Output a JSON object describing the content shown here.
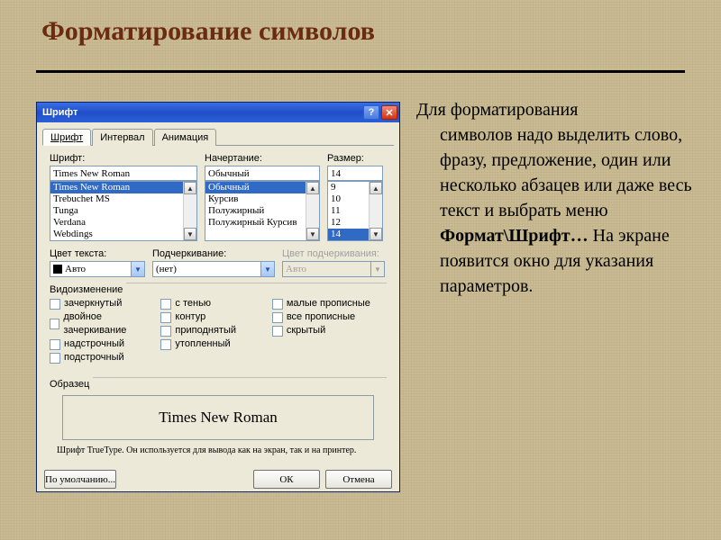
{
  "slide": {
    "title": "Форматирование символов"
  },
  "desc": {
    "line1": "Для форматирования",
    "line2": "символов надо выделить слово, фразу, предложение, один или несколько абзацев или даже весь текст и выбрать меню ",
    "bold": "Формат\\Шрифт…",
    "line3": " На экране появится окно для указания параметров."
  },
  "dialog": {
    "title": "Шрифт",
    "help": "?",
    "close": "✕",
    "tabs": {
      "font": "Шрифт",
      "interval": "Интервал",
      "animation": "Анимация"
    },
    "labels": {
      "font": "Шрифт:",
      "style": "Начертание:",
      "size": "Размер:",
      "color": "Цвет текста:",
      "underline": "Подчеркивание:",
      "underline_color": "Цвет подчеркивания:",
      "modifications": "Видоизменение",
      "sample": "Образец"
    },
    "font": {
      "value": "Times New Roman",
      "list": [
        "Times New Roman",
        "Trebuchet MS",
        "Tunga",
        "Verdana",
        "Webdings"
      ]
    },
    "style": {
      "value": "Обычный",
      "list": [
        "Обычный",
        "Курсив",
        "Полужирный",
        "Полужирный Курсив"
      ]
    },
    "size": {
      "value": "14",
      "list": [
        "9",
        "10",
        "11",
        "12",
        "14"
      ]
    },
    "color": {
      "value": "Авто"
    },
    "underline": {
      "value": "(нет)"
    },
    "underline_color": {
      "value": "Авто"
    },
    "checks": {
      "strike": "зачеркнутый",
      "dblstrike": "двойное зачеркивание",
      "super": "надстрочный",
      "sub": "подстрочный",
      "shadow": "с тенью",
      "outline": "контур",
      "emboss": "приподнятый",
      "engrave": "утопленный",
      "smallcaps": "малые прописные",
      "allcaps": "все прописные",
      "hidden": "скрытый"
    },
    "sample_text": "Times New Roman",
    "hint": "Шрифт TrueType. Он используется для вывода как на экран, так и на принтер.",
    "buttons": {
      "default": "По умолчанию...",
      "ok": "ОК",
      "cancel": "Отмена"
    }
  }
}
